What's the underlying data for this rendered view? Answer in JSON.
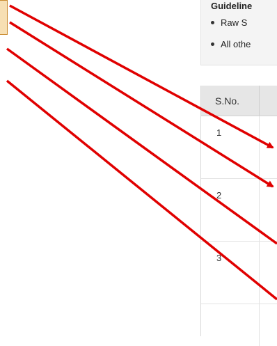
{
  "guidelines": {
    "title": "Guideline",
    "items": [
      {
        "text": "Raw S"
      },
      {
        "text": "All othe"
      }
    ]
  },
  "table": {
    "headers": [
      "S.No."
    ],
    "rows": [
      {
        "sno": "1"
      },
      {
        "sno": "2"
      },
      {
        "sno": "3"
      },
      {
        "sno": ""
      }
    ]
  },
  "colors": {
    "arrow": "#e00000",
    "callout_fill": "#f7dfb3",
    "callout_border": "#c98a2e",
    "header_bg": "#e6e6e6",
    "guidelines_bg": "#f4f4f4"
  },
  "annotations": {
    "arrow_count": 4,
    "arrow_icon": "red-arrow-icon"
  }
}
